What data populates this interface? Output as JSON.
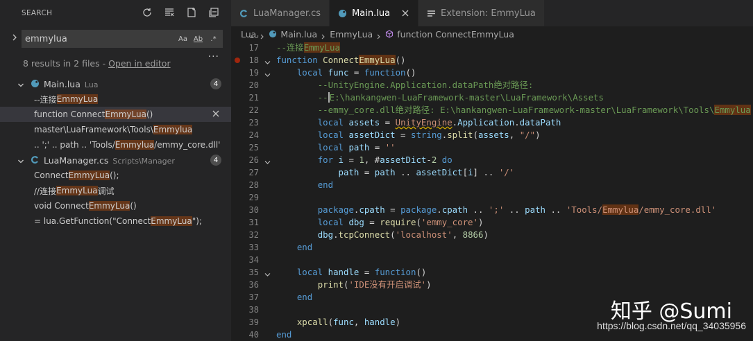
{
  "sidebar": {
    "title": "SEARCH",
    "query": "emmylua",
    "opt_case": "Aa",
    "opt_word": "Ab",
    "opt_regex": ".*",
    "more": "...",
    "summary": "8 results in 2 files - ",
    "open_in_editor": "Open in editor",
    "files": [
      {
        "name": "Main.lua",
        "path": "Lua",
        "count": "4",
        "matches": [
          {
            "pre": "--连接",
            "hit": "EmmyLua",
            "post": ""
          },
          {
            "pre": "function Connect",
            "hit": "EmmyLua",
            "post": "()"
          },
          {
            "pre": "master\\LuaFramework\\Tools\\",
            "hit": "Emmylua",
            "post": ""
          },
          {
            "pre": ".. ';' .. path .. 'Tools/",
            "hit": "Emmylua",
            "post": "/emmy_core.dll'"
          }
        ]
      },
      {
        "name": "LuaManager.cs",
        "path": "Scripts\\Manager",
        "count": "4",
        "matches": [
          {
            "pre": "Connect",
            "hit": "EmmyLua",
            "post": "();"
          },
          {
            "pre": "//连接",
            "hit": "EmmyLua",
            "post": "调试"
          },
          {
            "pre": "void Connect",
            "hit": "EmmyLua",
            "post": "()"
          },
          {
            "pre": "= lua.GetFunction(\"Connect",
            "hit": "EmmyLua",
            "post": "\");"
          }
        ]
      }
    ]
  },
  "tabs": [
    {
      "label": "LuaManager.cs",
      "active": false
    },
    {
      "label": "Main.lua",
      "active": true
    },
    {
      "label": "Extension: EmmyLua",
      "active": false
    }
  ],
  "breadcrumb": [
    "Lua",
    "Main.lua",
    "EmmyLua",
    "function ConnectEmmyLua"
  ],
  "code_lines": [
    {
      "n": "16",
      "t": []
    },
    {
      "n": "17",
      "t": [
        [
          "cm",
          "--连接"
        ],
        [
          "cm hl",
          "EmmyLua"
        ]
      ]
    },
    {
      "n": "18",
      "t": [
        [
          "kw",
          "function "
        ],
        [
          "fn",
          "Connect"
        ],
        [
          "fn hl",
          "EmmyLua"
        ],
        [
          "def",
          "()"
        ]
      ]
    },
    {
      "n": "19",
      "t": [
        [
          "def",
          "    "
        ],
        [
          "kw",
          "local "
        ],
        [
          "var",
          "func"
        ],
        [
          "def",
          " = "
        ],
        [
          "kw",
          "function"
        ],
        [
          "def",
          "()"
        ]
      ]
    },
    {
      "n": "20",
      "t": [
        [
          "def",
          "        "
        ],
        [
          "cm",
          "--UnityEngine.Application.dataPath绝对路径:"
        ]
      ]
    },
    {
      "n": "21",
      "t": [
        [
          "def",
          "        "
        ],
        [
          "cm",
          "--"
        ],
        [
          "cm cursor",
          ""
        ],
        [
          "cm",
          "E:\\hankangwen-LuaFramework-master\\LuaFramework\\Assets"
        ]
      ]
    },
    {
      "n": "22",
      "t": [
        [
          "def",
          "        "
        ],
        [
          "cm",
          "--emmy_core.dll绝对路径: E:\\hankangwen-LuaFramework-master\\LuaFramework\\Tools\\"
        ],
        [
          "cm hl",
          "Emmylua"
        ]
      ]
    },
    {
      "n": "23",
      "t": [
        [
          "def",
          "        "
        ],
        [
          "kw",
          "local "
        ],
        [
          "var",
          "assets"
        ],
        [
          "def",
          " = "
        ],
        [
          "str wavy",
          "UnityEngine"
        ],
        [
          "def",
          "."
        ],
        [
          "var",
          "Application"
        ],
        [
          "def",
          "."
        ],
        [
          "var",
          "dataPath"
        ]
      ]
    },
    {
      "n": "24",
      "t": [
        [
          "def",
          "        "
        ],
        [
          "kw",
          "local "
        ],
        [
          "var",
          "assetDict"
        ],
        [
          "def",
          " = "
        ],
        [
          "kw",
          "string"
        ],
        [
          "def",
          "."
        ],
        [
          "fn",
          "split"
        ],
        [
          "def",
          "("
        ],
        [
          "var",
          "assets"
        ],
        [
          "def",
          ", "
        ],
        [
          "str",
          "\"/\""
        ],
        [
          "def",
          ")"
        ]
      ]
    },
    {
      "n": "25",
      "t": [
        [
          "def",
          "        "
        ],
        [
          "kw",
          "local "
        ],
        [
          "var",
          "path"
        ],
        [
          "def",
          " = "
        ],
        [
          "str",
          "''"
        ]
      ]
    },
    {
      "n": "26",
      "t": [
        [
          "def",
          "        "
        ],
        [
          "kw",
          "for "
        ],
        [
          "var",
          "i"
        ],
        [
          "def",
          " = "
        ],
        [
          "num",
          "1"
        ],
        [
          "def",
          ", #"
        ],
        [
          "var",
          "assetDict"
        ],
        [
          "def",
          "-"
        ],
        [
          "num",
          "2"
        ],
        [
          "kw",
          " do"
        ]
      ]
    },
    {
      "n": "27",
      "t": [
        [
          "def",
          "            "
        ],
        [
          "var",
          "path"
        ],
        [
          "def",
          " = "
        ],
        [
          "var",
          "path"
        ],
        [
          "def",
          " .. "
        ],
        [
          "var",
          "assetDict"
        ],
        [
          "def",
          "["
        ],
        [
          "var",
          "i"
        ],
        [
          "def",
          "] .. "
        ],
        [
          "str",
          "'/'"
        ]
      ]
    },
    {
      "n": "28",
      "t": [
        [
          "def",
          "        "
        ],
        [
          "kw",
          "end"
        ]
      ]
    },
    {
      "n": "29",
      "t": []
    },
    {
      "n": "30",
      "t": [
        [
          "def",
          "        "
        ],
        [
          "kw",
          "package"
        ],
        [
          "def",
          "."
        ],
        [
          "var",
          "cpath"
        ],
        [
          "def",
          " = "
        ],
        [
          "kw",
          "package"
        ],
        [
          "def",
          "."
        ],
        [
          "var",
          "cpath"
        ],
        [
          "def",
          " .. "
        ],
        [
          "str",
          "';'"
        ],
        [
          "def",
          " .. "
        ],
        [
          "var",
          "path"
        ],
        [
          "def",
          " .. "
        ],
        [
          "str",
          "'Tools/"
        ],
        [
          "str hl",
          "Emmylua"
        ],
        [
          "str",
          "/emmy_core.dll'"
        ]
      ]
    },
    {
      "n": "31",
      "t": [
        [
          "def",
          "        "
        ],
        [
          "kw",
          "local "
        ],
        [
          "var",
          "dbg"
        ],
        [
          "def",
          " = "
        ],
        [
          "fn",
          "require"
        ],
        [
          "def",
          "("
        ],
        [
          "str",
          "'emmy_core'"
        ],
        [
          "def",
          ")"
        ]
      ]
    },
    {
      "n": "32",
      "t": [
        [
          "def",
          "        "
        ],
        [
          "var",
          "dbg"
        ],
        [
          "def",
          "."
        ],
        [
          "fn",
          "tcpConnect"
        ],
        [
          "def",
          "("
        ],
        [
          "str",
          "'localhost'"
        ],
        [
          "def",
          ", "
        ],
        [
          "num",
          "8866"
        ],
        [
          "def",
          ")"
        ]
      ]
    },
    {
      "n": "33",
      "t": [
        [
          "def",
          "    "
        ],
        [
          "kw",
          "end"
        ]
      ]
    },
    {
      "n": "34",
      "t": []
    },
    {
      "n": "35",
      "t": [
        [
          "def",
          "    "
        ],
        [
          "kw",
          "local "
        ],
        [
          "var",
          "handle"
        ],
        [
          "def",
          " = "
        ],
        [
          "kw",
          "function"
        ],
        [
          "def",
          "()"
        ]
      ]
    },
    {
      "n": "36",
      "t": [
        [
          "def",
          "        "
        ],
        [
          "fn",
          "print"
        ],
        [
          "def",
          "("
        ],
        [
          "str",
          "'IDE没有开启调试'"
        ],
        [
          "def",
          ")"
        ]
      ]
    },
    {
      "n": "37",
      "t": [
        [
          "def",
          "    "
        ],
        [
          "kw",
          "end"
        ]
      ]
    },
    {
      "n": "38",
      "t": []
    },
    {
      "n": "39",
      "t": [
        [
          "def",
          "    "
        ],
        [
          "fn",
          "xpcall"
        ],
        [
          "def",
          "("
        ],
        [
          "var",
          "func"
        ],
        [
          "def",
          ", "
        ],
        [
          "var",
          "handle"
        ],
        [
          "def",
          ")"
        ]
      ]
    },
    {
      "n": "40",
      "t": [
        [
          "kw",
          "end"
        ]
      ]
    }
  ],
  "folds": [
    "18",
    "19",
    "26",
    "35"
  ],
  "breakpoint_line": "18",
  "watermark": "知乎 @Sumi",
  "watermark_url": "https://blog.csdn.net/qq_34035956",
  "colors": {
    "match_highlight": "#ea5c00",
    "accent": "#569cd6"
  }
}
